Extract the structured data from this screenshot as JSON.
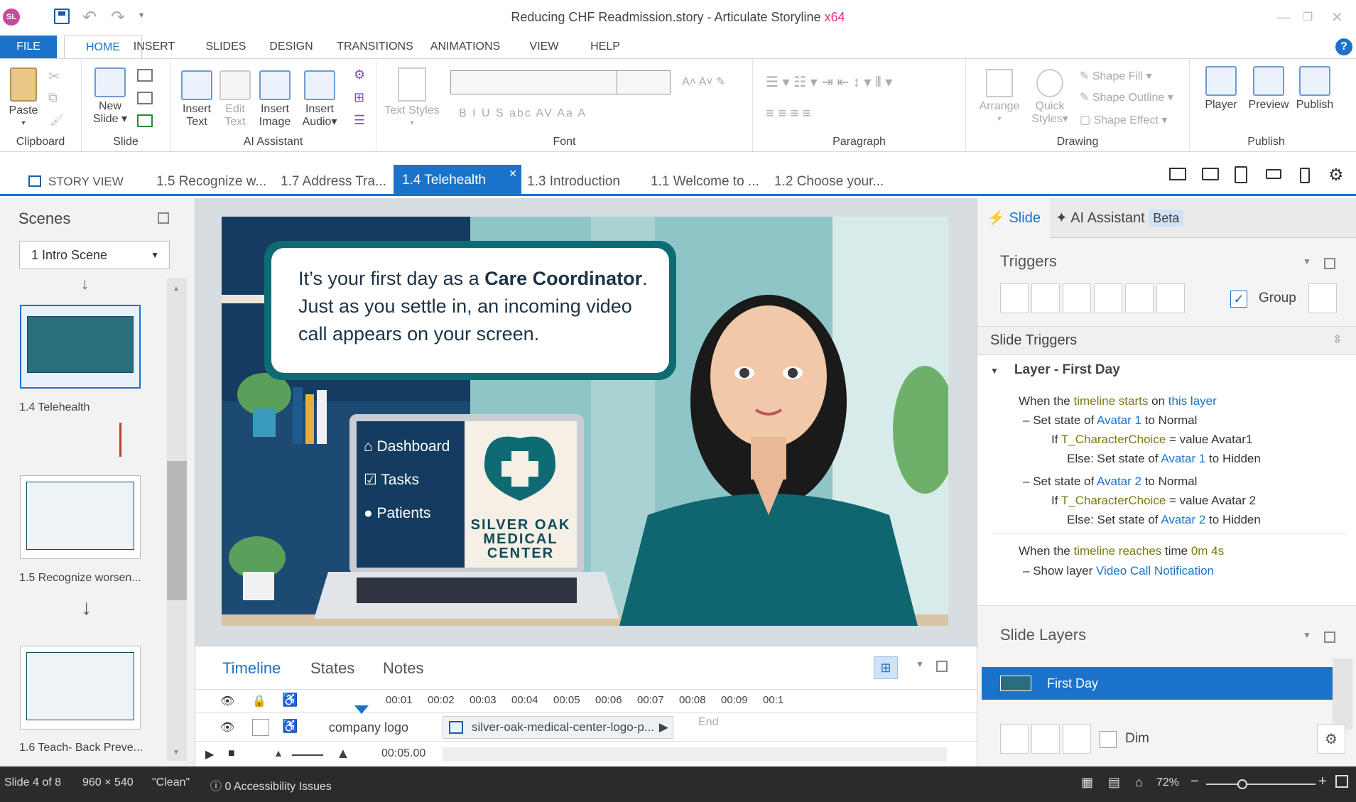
{
  "app": {
    "logo_text": "SL",
    "title": "Reducing CHF Readmission.story - ",
    "title_app": "Articulate Storyline",
    "title_arch": "x64"
  },
  "ribbon_tabs": [
    {
      "label": "FILE"
    },
    {
      "label": "HOME"
    },
    {
      "label": "INSERT"
    },
    {
      "label": "SLIDES"
    },
    {
      "label": "DESIGN"
    },
    {
      "label": "TRANSITIONS"
    },
    {
      "label": "ANIMATIONS"
    },
    {
      "label": "VIEW"
    },
    {
      "label": "HELP"
    }
  ],
  "ribbon": {
    "clipboard": {
      "label": "Clipboard",
      "paste": "Paste"
    },
    "slide": {
      "label": "Slide",
      "new_slide": "New",
      "new_slide2": "Slide"
    },
    "ai": {
      "label": "AI Assistant",
      "insert_text": "Insert",
      "insert_text2": "Text",
      "edit_text": "Edit",
      "edit_text2": "Text",
      "insert_image": "Insert",
      "insert_image2": "Image",
      "insert_audio": "Insert",
      "insert_audio2": "Audio"
    },
    "font": {
      "label": "Font",
      "text_styles": "Text Styles",
      "row2": "B  I  U  S  abc  AV  Aa  A"
    },
    "paragraph": {
      "label": "Paragraph"
    },
    "drawing": {
      "label": "Drawing",
      "arrange": "Arrange",
      "quick": "Quick",
      "styles": "Styles",
      "fill": "Shape Fill",
      "outline": "Shape Outline",
      "effect": "Shape Effect"
    },
    "publish": {
      "label": "Publish",
      "player": "Player",
      "preview": "Preview",
      "publish": "Publish"
    }
  },
  "doc_tabs": {
    "story_view": "STORY VIEW",
    "tabs": [
      {
        "label": "1.5 Recognize w..."
      },
      {
        "label": "1.7 Address Tra..."
      },
      {
        "label": "1.4 Telehealth"
      },
      {
        "label": "1.3 Introduction"
      },
      {
        "label": "1.1 Welcome to ..."
      },
      {
        "label": "1.2 Choose your..."
      }
    ]
  },
  "scenes": {
    "title": "Scenes",
    "selected_scene": "1 Intro Scene",
    "items": [
      {
        "label": "1.4 Telehealth"
      },
      {
        "label": "1.5 Recognize worsen..."
      },
      {
        "label": "1.6 Teach- Back Preve..."
      }
    ]
  },
  "slide": {
    "bubble_line1_a": "It’s your first day as a ",
    "bubble_line1_b": "Care Coordinator",
    "bubble_line1_c": ".",
    "bubble_line2": "Just as you settle in, an incoming video",
    "bubble_line3": "call appears on your screen.",
    "menu": [
      {
        "label": "Dashboard"
      },
      {
        "label": "Tasks"
      },
      {
        "label": "Patients"
      }
    ],
    "logo_l1": "SILVER OAK",
    "logo_l2": "MEDICAL",
    "logo_l3": "CENTER"
  },
  "timeline": {
    "tabs": [
      {
        "label": "Timeline"
      },
      {
        "label": "States"
      },
      {
        "label": "Notes"
      }
    ],
    "ticks": [
      "00:01",
      "00:02",
      "00:03",
      "00:04",
      "00:05",
      "00:06",
      "00:07",
      "00:08",
      "00:09",
      "00:1"
    ],
    "row_name": "company logo",
    "row_asset": "silver-oak-medical-center-logo-p...",
    "end_label": "End",
    "duration": "00:05.00"
  },
  "right_panel": {
    "tab_slide": "Slide",
    "tab_ai": "AI Assistant",
    "beta": "Beta",
    "triggers_title": "Triggers",
    "group_label": "Group",
    "slide_triggers": "Slide Triggers",
    "layer_header": "Layer - First Day",
    "t1": {
      "a": "When the ",
      "b": "timeline starts",
      "c": " on ",
      "d": "this layer"
    },
    "t2": {
      "a": "Set state of ",
      "b": "Avatar 1",
      "c": " to ",
      "d": "Normal"
    },
    "t3": {
      "a": "If ",
      "b": "T_CharacterChoice",
      "c": " = value ",
      "d": "Avatar1"
    },
    "t4": {
      "a": "Else: Set state of ",
      "b": "Avatar 1",
      "c": " to ",
      "d": "Hidden"
    },
    "t5": {
      "a": "Set state of ",
      "b": "Avatar 2",
      "c": " to ",
      "d": "Normal"
    },
    "t6": {
      "a": "If ",
      "b": "T_CharacterChoice",
      "c": " = value ",
      "d": "Avatar 2"
    },
    "t7": {
      "a": "Else: Set state of ",
      "b": "Avatar 2",
      "c": " to ",
      "d": "Hidden"
    },
    "t8": {
      "a": "When the ",
      "b": "timeline reaches",
      "c": " time ",
      "d": "0m 4s"
    },
    "t9": {
      "a": "Show layer ",
      "b": "Video Call Notification"
    },
    "layers_title": "Slide Layers",
    "layer_item": "First Day",
    "dim": "Dim"
  },
  "status": {
    "slide": "Slide 4 of 8",
    "size": "960 × 540",
    "theme": "\"Clean\"",
    "a11y": "0 Accessibility Issues",
    "zoom": "72%"
  },
  "colors": {
    "accent": "#1a73c9",
    "dark": "#2b2b2b",
    "teal": "#0e6b73"
  }
}
